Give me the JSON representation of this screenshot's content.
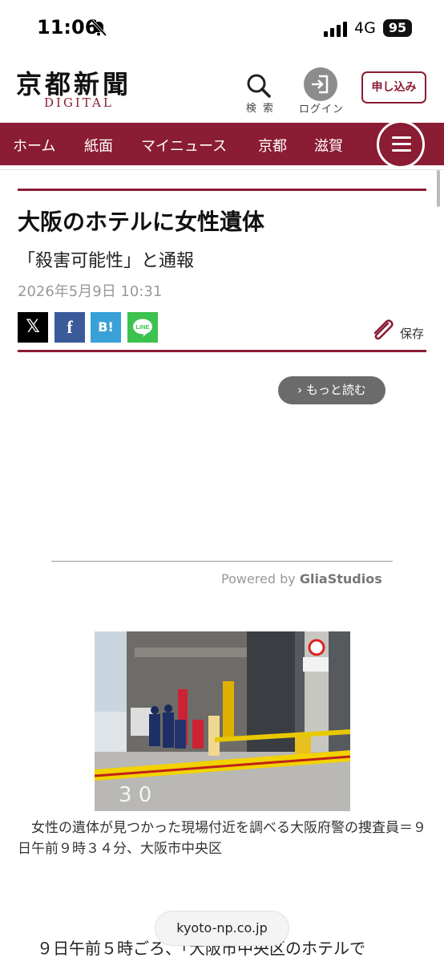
{
  "status_bar": {
    "time": "11:06",
    "network": "4G",
    "battery": "95"
  },
  "header": {
    "logo_title": "京都新聞",
    "logo_sub": "DIGITAL",
    "search_label": "検 索",
    "login_label": "ログイン",
    "apply_label": "申し込み"
  },
  "nav": {
    "items": [
      "ホーム",
      "紙面",
      "マイニュース",
      "京都",
      "滋賀"
    ]
  },
  "article": {
    "headline": "大阪のホテルに女性遺体",
    "subhead": "「殺害可能性」と通報",
    "date": "2026年5月9日 10:31",
    "share": {
      "x": "𝕏",
      "facebook": "f",
      "hatena": "B!",
      "line": "LINE"
    },
    "save_label": "保存",
    "video": {
      "more_label": "› もっと読む",
      "powered_prefix": "Powered by ",
      "powered_brand": "GliaStudios"
    },
    "photo_caption": "　女性の遺体が見つかった現場付近を調べる大阪府警の捜査員＝９日午前９時３４分、大阪市中央区",
    "body_start": "９日午前５時ごろ、「大阪市中央区のホテルで"
  },
  "browser": {
    "url": "kyoto-np.co.jp"
  },
  "colors": {
    "brand": "#8a1c33",
    "nav_text": "#ffffff",
    "date": "#999999"
  }
}
